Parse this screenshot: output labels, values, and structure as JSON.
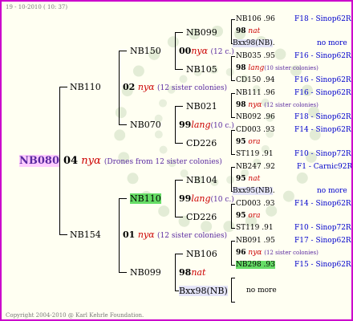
{
  "header": "19 - 10-2010 ( 10: 37)",
  "footer": "Copyright 2004-2010 @ Karl Kehrle Foundation.",
  "root": {
    "name": "NB080",
    "gen": "04",
    "race": "nyα",
    "note": "(Drones from 12 sister colonies)"
  },
  "g1": [
    {
      "name": "NB110",
      "gen": "02",
      "race": "nyα",
      "note": "(12 sister colonies)"
    },
    {
      "name": "NB154",
      "gen": "01",
      "race": "nyα",
      "note": "(12 sister colonies)"
    }
  ],
  "g2": [
    {
      "name": "NB150",
      "gen": "00",
      "race": "nyα",
      "note": "(12 c.)"
    },
    {
      "name": "NB070",
      "gen": "99",
      "race": "lang",
      "note": "(10 c.)"
    },
    {
      "name": "NB110",
      "gen": "99",
      "race": "lang",
      "note": "(10 c.)"
    },
    {
      "name": "NB099",
      "gen": "98",
      "race": "nat",
      "note": ""
    }
  ],
  "g3": [
    "NB099",
    "NB105",
    "NB021",
    "CD226",
    "NB104",
    "CD226",
    "NB106",
    "Bxx98(NB)"
  ],
  "g4": [
    {
      "name": "NB106",
      "year": ".96",
      "race": "",
      "note": "",
      "ref": "F18 - Sinop62R"
    },
    {
      "name": "98",
      "year": "",
      "race": "nat",
      "note": "",
      "ref": ""
    },
    {
      "name": "Bxx98(NB)",
      "year": ".",
      "race": "",
      "note": "",
      "ref": "no more"
    },
    {
      "name": "NB035",
      "year": ".95",
      "race": "",
      "note": "",
      "ref": "F16 - Sinop62R"
    },
    {
      "name": "98",
      "year": "",
      "race": "lang",
      "note": "(10 sister colonies)",
      "ref": ""
    },
    {
      "name": "CD150",
      "year": ".94",
      "race": "",
      "note": "",
      "ref": "F16 - Sinop62R"
    },
    {
      "name": "NB111",
      "year": ".96",
      "race": "",
      "note": "",
      "ref": "F16 - Sinop62R"
    },
    {
      "name": "98",
      "year": "",
      "race": "nyα",
      "note": "(12 sister colonies)",
      "ref": ""
    },
    {
      "name": "NB092",
      "year": ".96",
      "race": "",
      "note": "",
      "ref": "F18 - Sinop62R"
    },
    {
      "name": "CD003",
      "year": ".93",
      "race": "",
      "note": "",
      "ref": "F14 - Sinop62R"
    },
    {
      "name": "95",
      "year": "",
      "race": "ora",
      "note": "",
      "ref": ""
    },
    {
      "name": "ST119",
      "year": ".91",
      "race": "",
      "note": "",
      "ref": "F10 - Sinop72R"
    },
    {
      "name": "NB247",
      "year": ".92",
      "race": "",
      "note": "",
      "ref": "F1 - Carnic92R"
    },
    {
      "name": "95",
      "year": "",
      "race": "nat",
      "note": "",
      "ref": ""
    },
    {
      "name": "Bxx95(NB)",
      "year": ".",
      "race": "",
      "note": "",
      "ref": "no more"
    },
    {
      "name": "CD003",
      "year": ".93",
      "race": "",
      "note": "",
      "ref": "F14 - Sinop62R"
    },
    {
      "name": "95",
      "year": "",
      "race": "ora",
      "note": "",
      "ref": ""
    },
    {
      "name": "ST119",
      "year": ".91",
      "race": "",
      "note": "",
      "ref": "F10 - Sinop72R"
    },
    {
      "name": "NB091",
      "year": ".95",
      "race": "",
      "note": "",
      "ref": "F17 - Sinop62R"
    },
    {
      "name": "96",
      "year": "",
      "race": "nyα",
      "note": "(12 sister colonies)",
      "ref": ""
    },
    {
      "name": "NB298",
      "year": ".93",
      "race": "",
      "note": "",
      "ref": "F15 - Sinop62R"
    },
    {
      "name": "",
      "year": "",
      "race": "",
      "note": "",
      "ref": ""
    },
    {
      "name": "",
      "year": "",
      "race": "",
      "note": "",
      "ref": "no more"
    },
    {
      "name": "",
      "year": "",
      "race": "",
      "note": "",
      "ref": ""
    }
  ],
  "colors": {
    "border": "#cc00cc",
    "root_highlight": "#ffccff",
    "green_highlight": "#66dd66",
    "ref": "#0000cc",
    "race": "#cc0000"
  }
}
